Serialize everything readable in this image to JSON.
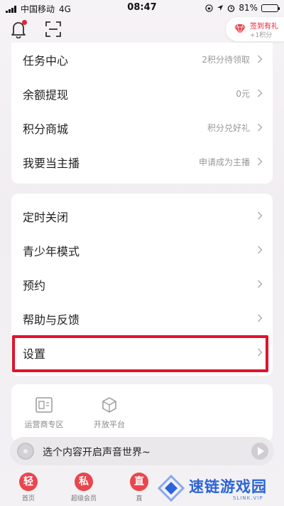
{
  "status_bar": {
    "carrier": "中国移动",
    "network": "4G",
    "time": "08:47",
    "battery_percent": "81%",
    "battery_level": 0.81
  },
  "header": {
    "checkin_title": "签到有礼",
    "checkin_subtitle": "+1积分"
  },
  "account_menu": [
    {
      "label": "任务中心",
      "value": "2积分待领取"
    },
    {
      "label": "余额提现",
      "value": "0元"
    },
    {
      "label": "积分商城",
      "value": "积分兑好礼"
    },
    {
      "label": "我要当主播",
      "value": "申请成为主播"
    }
  ],
  "general_menu": [
    {
      "label": "定时关闭"
    },
    {
      "label": "青少年模式"
    },
    {
      "label": "预约"
    },
    {
      "label": "帮助与反馈"
    },
    {
      "label": "设置"
    }
  ],
  "tools": [
    {
      "label": "运营商专区",
      "icon": "sim-card-icon"
    },
    {
      "label": "开放平台",
      "icon": "cube-icon"
    }
  ],
  "player": {
    "text": "选个内容开启声音世界~"
  },
  "tabbar": [
    {
      "glyph": "轻",
      "label": "首页"
    },
    {
      "glyph": "私",
      "label": "超级会员"
    },
    {
      "glyph": "直",
      "label": "直"
    }
  ],
  "watermark": {
    "text": "速链游戏园",
    "sub": "SLINK.VIP"
  },
  "colors": {
    "accent": "#e3122d",
    "brand_red": "#e8464e",
    "watermark_blue": "#2b64d8"
  }
}
